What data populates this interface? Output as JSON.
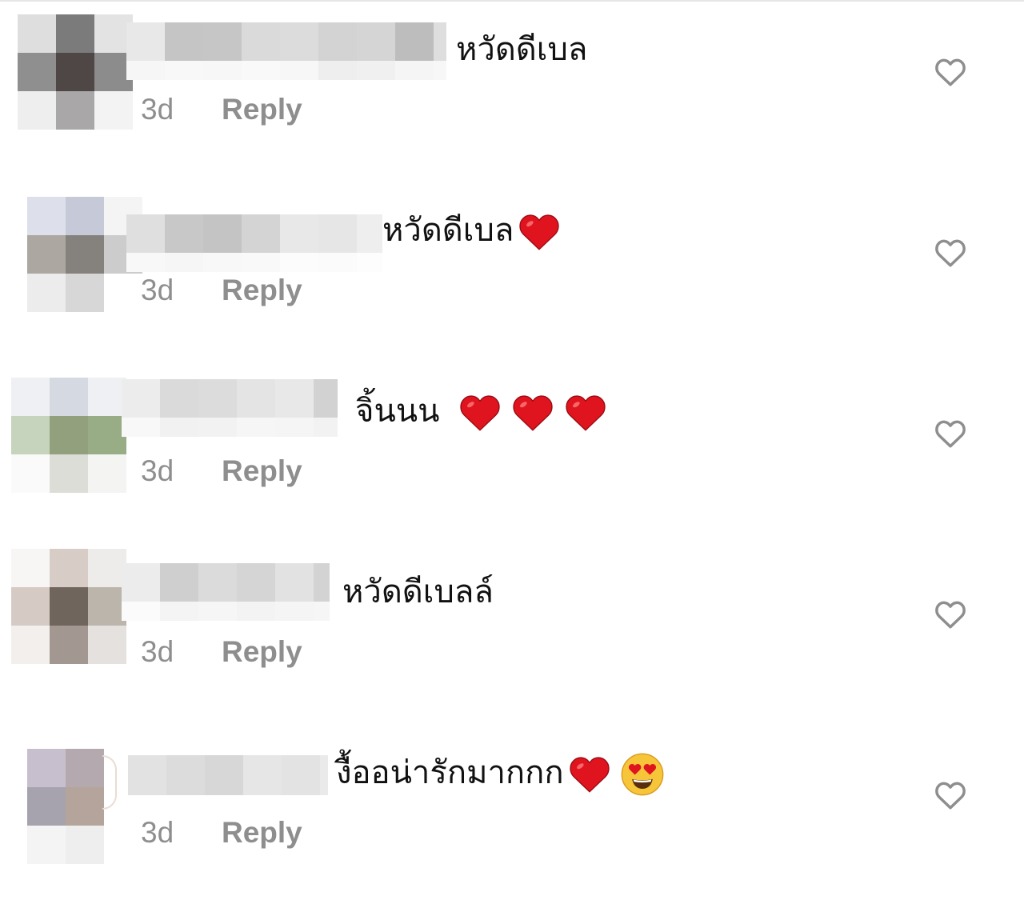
{
  "accent": {
    "heart_red": "#e0141f",
    "meta_gray": "#8e8e8e",
    "text": "#111111"
  },
  "comments": [
    {
      "text": "หวัดดีเบล",
      "emojis": [],
      "time": "3d",
      "reply_label": "Reply",
      "like_icon": "heart-outline-icon"
    },
    {
      "text": "หวัดดีเบล",
      "emojis": [
        "red-heart-emoji"
      ],
      "time": "3d",
      "reply_label": "Reply",
      "like_icon": "heart-outline-icon"
    },
    {
      "text": "จิ้นนน ",
      "emojis": [
        "red-heart-emoji",
        "red-heart-emoji",
        "red-heart-emoji"
      ],
      "time": "3d",
      "reply_label": "Reply",
      "like_icon": "heart-outline-icon"
    },
    {
      "text": "หวัดดีเบลล์",
      "emojis": [],
      "time": "3d",
      "reply_label": "Reply",
      "like_icon": "heart-outline-icon"
    },
    {
      "text": "งื้ออน่ารักมากกก",
      "emojis": [
        "red-heart-emoji",
        "heart-eyes-emoji"
      ],
      "time": "3d",
      "reply_label": "Reply",
      "like_icon": "heart-outline-icon"
    }
  ]
}
